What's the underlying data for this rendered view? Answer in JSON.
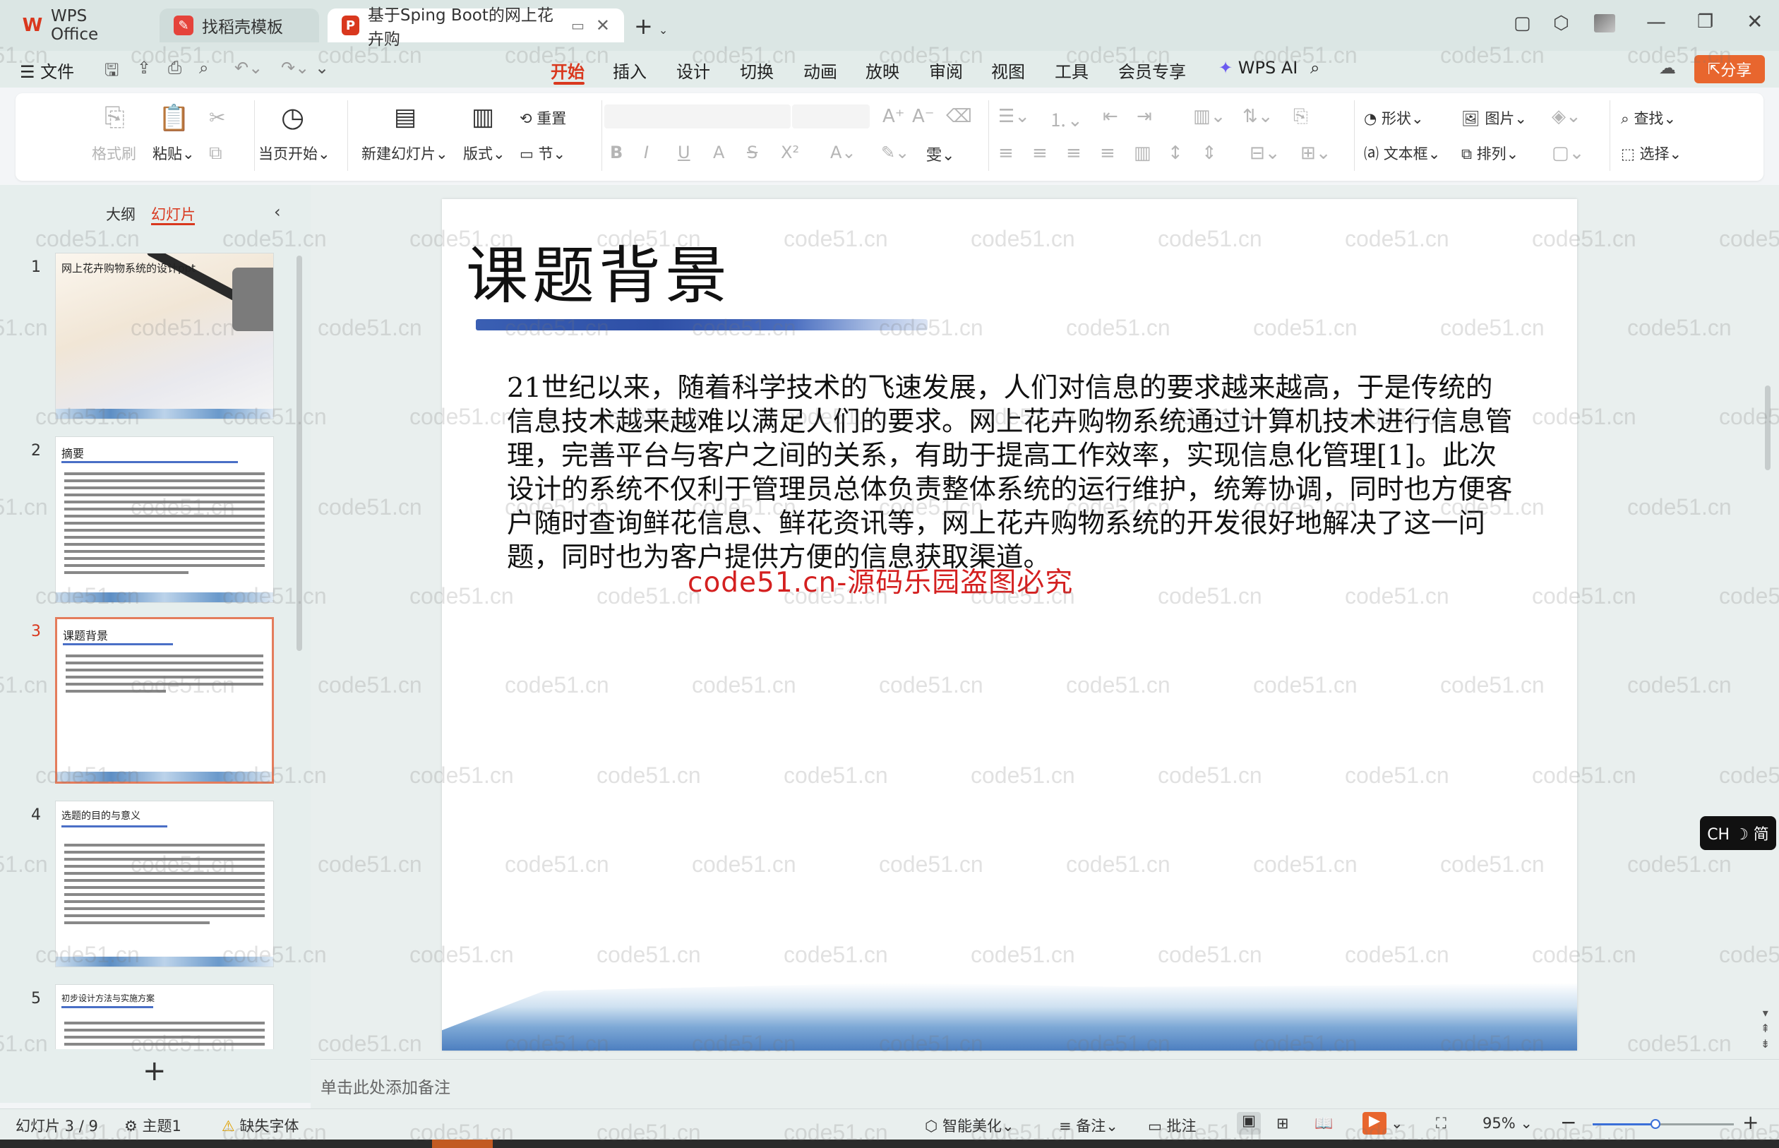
{
  "window": {
    "tabs": [
      {
        "label": "WPS Office",
        "icon": "wps-logo-icon"
      },
      {
        "label": "找稻壳模板",
        "icon": "docer-icon"
      },
      {
        "label": "基于Sping Boot的网上花卉购",
        "icon": "ppt-icon"
      }
    ],
    "new_tab": "+",
    "accent": "#d9381e"
  },
  "menubar": {
    "file": "文件",
    "items": [
      "开始",
      "插入",
      "设计",
      "切换",
      "动画",
      "放映",
      "审阅",
      "视图",
      "工具",
      "会员专享"
    ],
    "wps_ai": "WPS AI",
    "share": "分享"
  },
  "ribbon": {
    "format_painter": "格式刷",
    "paste": "粘贴",
    "play_current": "当页开始",
    "new_slide": "新建幻灯片",
    "layout": "版式",
    "reset": "重置",
    "section": "节",
    "shape": "形状",
    "picture": "图片",
    "find": "查找",
    "textbox": "文本框",
    "arrange": "排列",
    "select": "选择"
  },
  "panel": {
    "tab_outline": "大纲",
    "tab_slides": "幻灯片",
    "add": "+",
    "thumbs": [
      {
        "num": "1",
        "title": "网上花卉购物系统的设计ppt"
      },
      {
        "num": "2",
        "title": "摘要"
      },
      {
        "num": "3",
        "title": "课题背景"
      },
      {
        "num": "4",
        "title": "选题的目的与意义"
      },
      {
        "num": "5",
        "title": "初步设计方法与实施方案"
      }
    ]
  },
  "slide": {
    "title": "课题背景",
    "body": "21世纪以来，随着科学技术的飞速发展，人们对信息的要求越来越高，于是传统的信息技术越来越难以满足人们的要求。网上花卉购物系统通过计算机技术进行信息管理，完善平台与客户之间的关系，有助于提高工作效率，实现信息化管理[1]。此次设计的系统不仅利于管理员总体负责整体系统的运行维护，统筹协调，同时也方便客户随时查询鲜花信息、鲜花资讯等，网上花卉购物系统的开发很好地解决了这一问题，同时也为客户提供方便的信息获取渠道。",
    "overlay_watermark": "code51.cn-源码乐园盗图必究"
  },
  "notes_placeholder": "单击此处添加备注",
  "status": {
    "slide_counter": "幻灯片 3 / 9",
    "theme": "主题1",
    "missing_font": "缺失字体",
    "beautify": "智能美化",
    "notes": "备注",
    "comments": "批注",
    "zoom": "95%"
  },
  "ime": "CH ☽ 简",
  "watermark_text": "code51.cn"
}
